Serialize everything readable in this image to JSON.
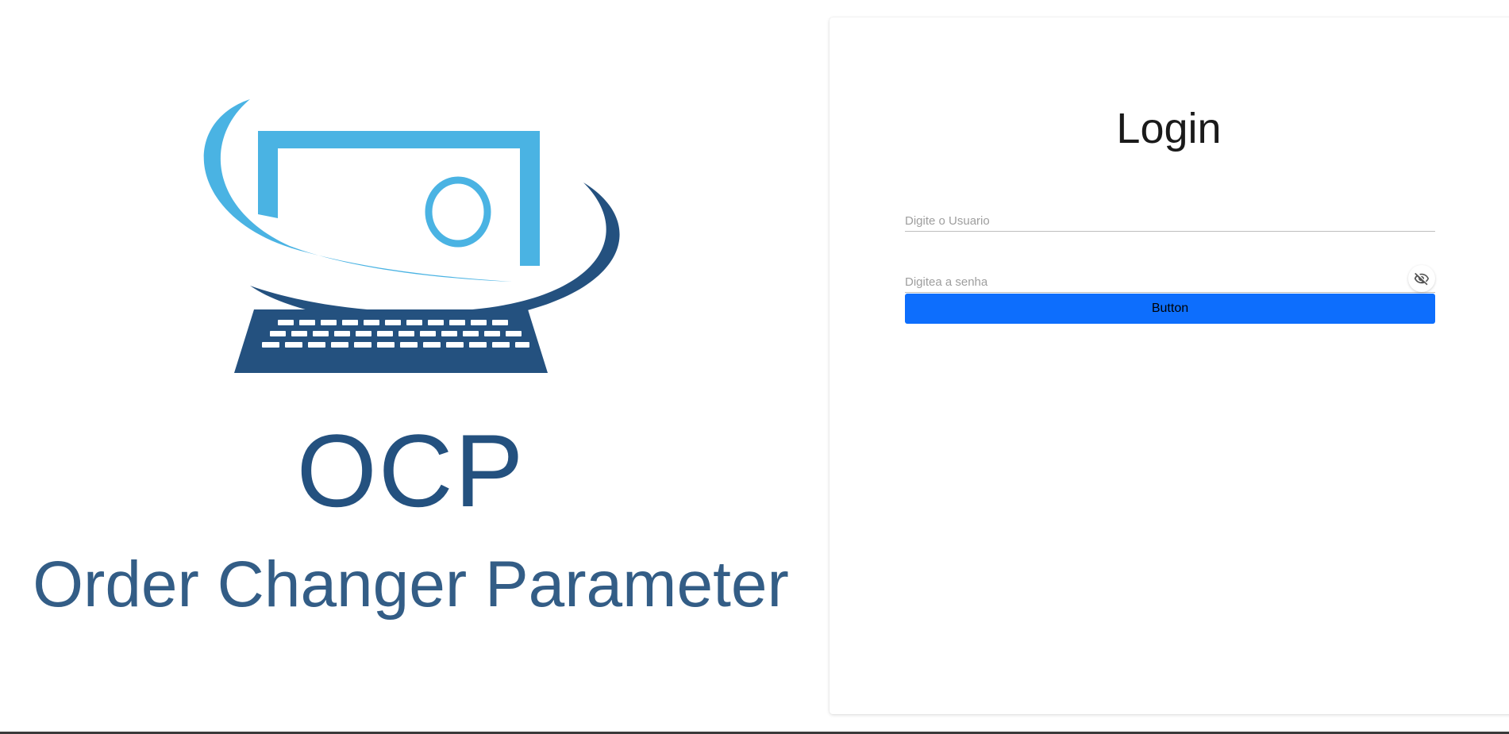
{
  "brand": {
    "acronym": "OCP",
    "full_name": "Order Changer Parameter",
    "logo_icon": "computer-monitor-keyboard-logo",
    "colors": {
      "light_blue": "#4ab3e3",
      "dark_blue": "#24517f"
    }
  },
  "login": {
    "title": "Login",
    "username_placeholder": "Digite o Usuario",
    "username_value": "",
    "password_placeholder": "Digitea a senha",
    "password_value": "",
    "toggle_icon": "eye-slash-icon",
    "submit_label": "Button",
    "submit_color": "#0d6efd"
  }
}
